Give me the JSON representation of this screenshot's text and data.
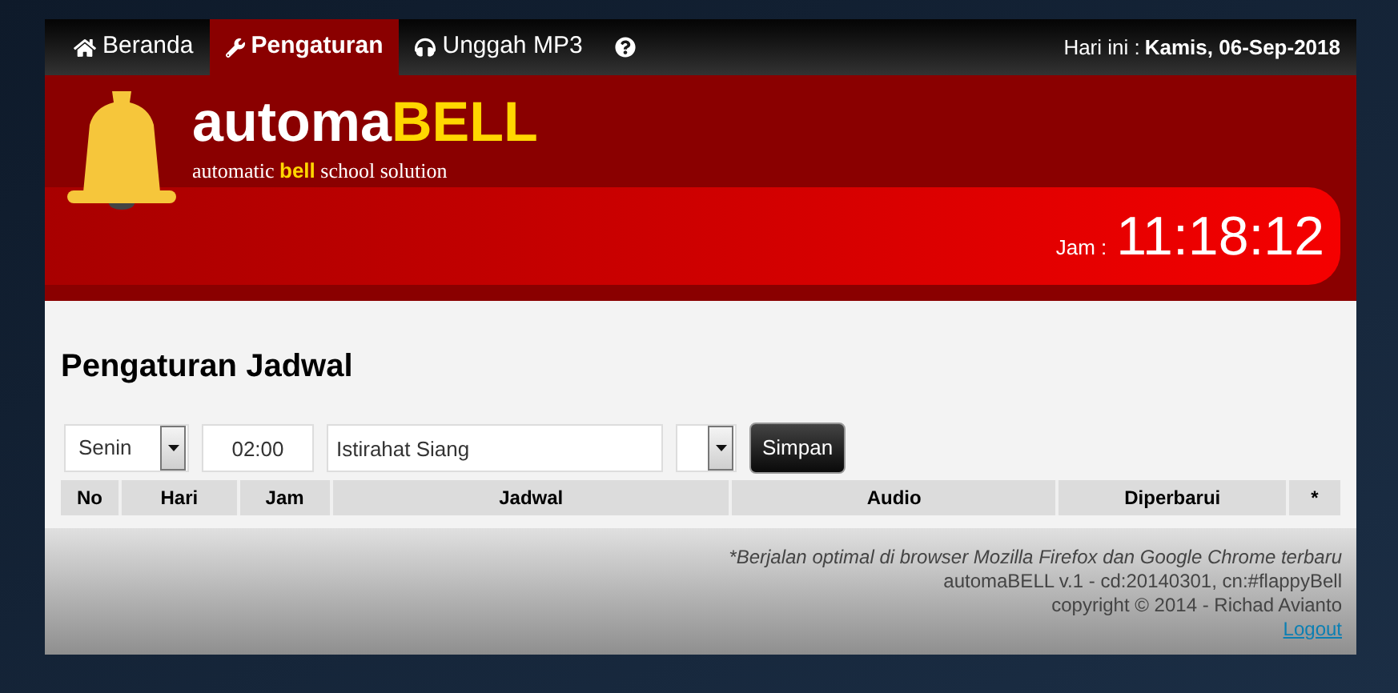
{
  "nav": {
    "items": [
      {
        "label": "Beranda",
        "selected": false
      },
      {
        "label": "Pengaturan",
        "selected": true
      },
      {
        "label": "Unggah MP3",
        "selected": false
      },
      {
        "selected": false
      }
    ],
    "date_label": "Hari ini : ",
    "date_value": "Kamis, 06-Sep-2018"
  },
  "header": {
    "logo_main": "automa",
    "logo_accent": "BELL",
    "tagline": "automatic **bell** school solution",
    "clock_label": "Jam :",
    "clock_time": "11:18:12"
  },
  "page": {
    "title": "Pengaturan Jadwal",
    "form": {
      "day": "Senin",
      "time": "02:00",
      "schedule": "Istirahat Siang",
      "save": "Simpan"
    },
    "table": {
      "columns": [
        "No",
        "Hari",
        "Jam",
        "Jadwal",
        "Audio",
        "Diperbarui",
        "*"
      ]
    }
  },
  "footer": {
    "note": "*Berjalan optimal di browser Mozilla Firefox dan Google Chrome terbaru",
    "version": "automaBELL v.1 - cd:20140301, cn:#flappyBell",
    "copyright": "copyright © 2014 - Richad Avianto",
    "logout": "Logout"
  }
}
